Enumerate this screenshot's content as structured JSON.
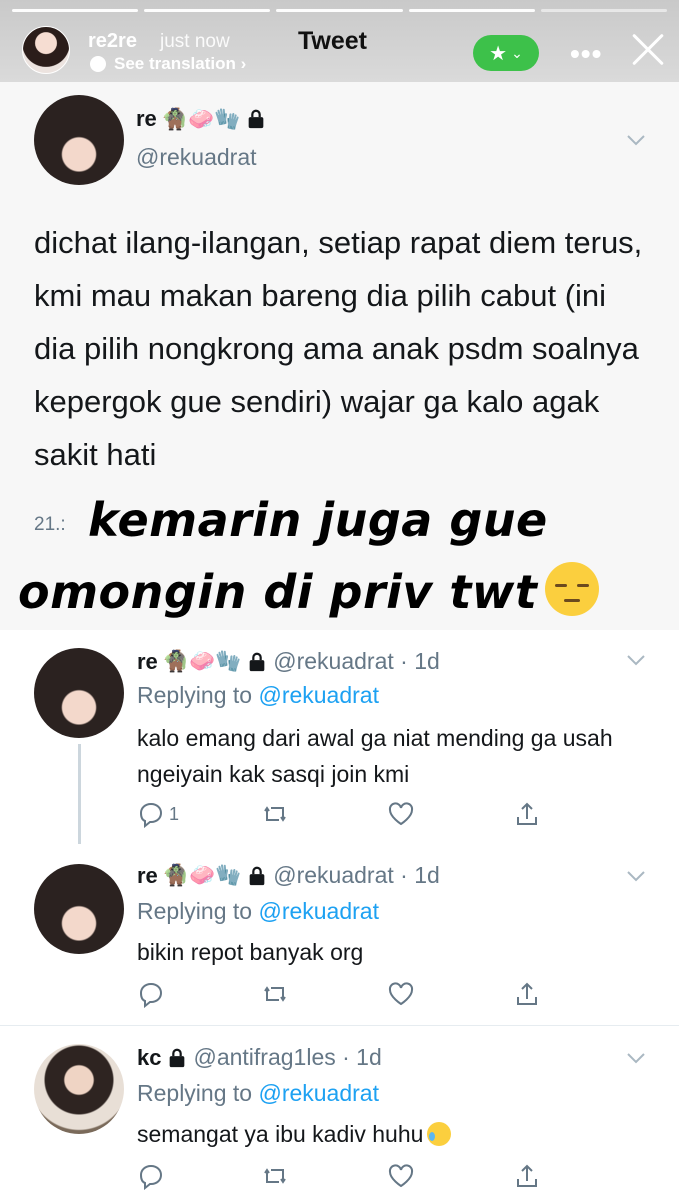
{
  "story": {
    "username": "re2re",
    "time": "just now",
    "see_translation": "See translation ›",
    "title": "Tweet",
    "more": "•••"
  },
  "main_tweet": {
    "name": "re",
    "emojis": "🧌🧼🧤",
    "handle": "@rekuadrat",
    "text": "dichat ilang-ilangan, setiap rapat diem terus, kmi mau makan bareng dia pilih cabut (ini dia pilih nongkrong ama anak psdm soalnya kepergok gue sendiri) wajar ga kalo agak sakit hati",
    "date_fragment": "21.:",
    "overlay_line1": "kemarin juga gue",
    "overlay_line2": "omongin di priv twt"
  },
  "replies": [
    {
      "name": "re",
      "emojis": "🧌🧼🧤",
      "handle_time": "@rekuadrat · 1d",
      "replying_prefix": "Replying to ",
      "replying_to": "@rekuadrat",
      "text": "kalo emang dari awal ga niat mending ga usah ngeiyain kak sasqi join kmi",
      "reply_count": "1"
    },
    {
      "name": "re",
      "emojis": "🧌🧼🧤",
      "handle_time": "@rekuadrat · 1d",
      "replying_prefix": "Replying to ",
      "replying_to": "@rekuadrat",
      "text": "bikin repot banyak org",
      "reply_count": ""
    },
    {
      "name": "kc",
      "emojis": "",
      "handle_time": "@antifrag1les · 1d",
      "replying_prefix": "Replying to ",
      "replying_to": "@rekuadrat",
      "text": "semangat ya ibu kadiv huhu",
      "reply_count": ""
    }
  ],
  "colors": {
    "link": "#1da1f2",
    "muted": "#657786",
    "favorite_pill": "#3dc14a"
  }
}
